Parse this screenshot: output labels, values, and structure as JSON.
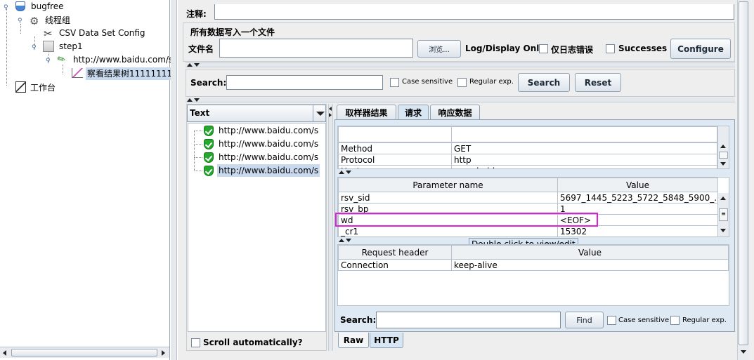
{
  "tree": {
    "root": "bugfree",
    "thread_group": "线程组",
    "csv": "CSV Data Set Config",
    "step": "step1",
    "sampler": "http://www.baidu.com/s",
    "listener": "察看结果树11111111",
    "workbench": "工作台"
  },
  "top": {
    "comment_label": "注释:",
    "write_all_label": "所有数据写入一个文件",
    "filename_label": "文件名",
    "browse_label": "浏览...",
    "log_display_label": "Log/Display Only:",
    "errors_only_label": "仅日志错误",
    "successes_label": "Successes",
    "configure_label": "Configure"
  },
  "search_bar": {
    "label": "Search:",
    "case_label": "Case sensitive",
    "regex_label": "Regular exp.",
    "search_btn": "Search",
    "reset_btn": "Reset"
  },
  "results": {
    "renderer": "Text",
    "items": [
      "http://www.baidu.com/s",
      "http://www.baidu.com/s",
      "http://www.baidu.com/s",
      "http://www.baidu.com/s"
    ],
    "scroll_label": "Scroll automatically?"
  },
  "tabs": [
    "取样器结果",
    "请求",
    "响应数据"
  ],
  "request_table": [
    [
      "Method",
      "GET"
    ],
    [
      "Protocol",
      "http"
    ],
    [
      "Host",
      "www.baidu.com"
    ]
  ],
  "params": {
    "headers": [
      "Parameter name",
      "Value"
    ],
    "rows": [
      [
        "rsv_sid",
        "5697_1445_5223_5722_5848_5900_..."
      ],
      [
        "rsv_bp",
        "1"
      ],
      [
        "wd",
        "<EOF>"
      ],
      [
        "_cr1",
        "15302"
      ]
    ]
  },
  "tooltip": "Double click to view/edit",
  "req_headers": {
    "headers": [
      "Request header",
      "Value"
    ],
    "rows": [
      [
        "Connection",
        "keep-alive"
      ]
    ]
  },
  "find": {
    "label": "Search:",
    "find_btn": "Find",
    "case_label": "Case sensitive",
    "regex_label": "Regular exp."
  },
  "bottom_tabs": [
    "Raw",
    "HTTP"
  ],
  "colors": {
    "highlight": "#e020d8",
    "accent": "#c9d9ee"
  }
}
